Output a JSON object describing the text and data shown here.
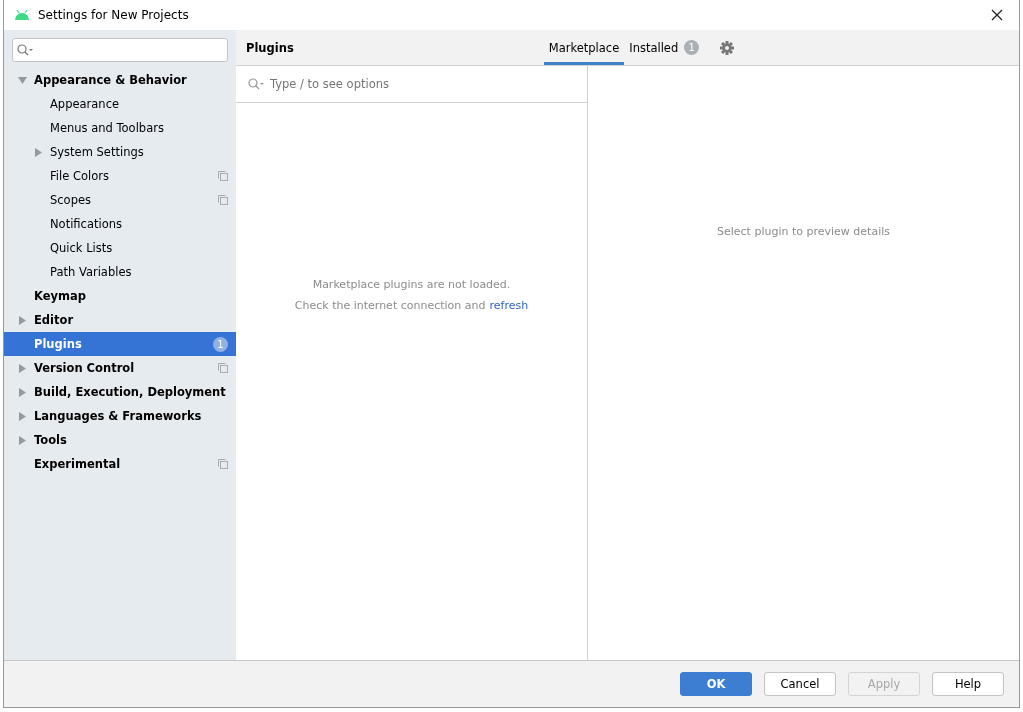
{
  "window": {
    "title": "Settings for New Projects"
  },
  "sidebar": {
    "items": [
      {
        "label": "Appearance & Behavior",
        "bold": true,
        "expanded": true,
        "selected": false,
        "per_project": false,
        "children": [
          {
            "label": "Appearance",
            "bold": false,
            "selected": false,
            "per_project": false
          },
          {
            "label": "Menus and Toolbars",
            "bold": false,
            "selected": false,
            "per_project": false
          },
          {
            "label": "System Settings",
            "bold": false,
            "expanded": false,
            "selected": false,
            "per_project": false
          },
          {
            "label": "File Colors",
            "bold": false,
            "selected": false,
            "per_project": true
          },
          {
            "label": "Scopes",
            "bold": false,
            "selected": false,
            "per_project": true
          },
          {
            "label": "Notifications",
            "bold": false,
            "selected": false,
            "per_project": false
          },
          {
            "label": "Quick Lists",
            "bold": false,
            "selected": false,
            "per_project": false
          },
          {
            "label": "Path Variables",
            "bold": false,
            "selected": false,
            "per_project": false
          }
        ]
      },
      {
        "label": "Keymap",
        "bold": true,
        "selected": false,
        "per_project": false
      },
      {
        "label": "Editor",
        "bold": true,
        "expanded": false,
        "selected": false,
        "per_project": false
      },
      {
        "label": "Plugins",
        "bold": true,
        "selected": true,
        "per_project": false,
        "badge": "1"
      },
      {
        "label": "Version Control",
        "bold": true,
        "expanded": false,
        "selected": false,
        "per_project": true
      },
      {
        "label": "Build, Execution, Deployment",
        "bold": true,
        "expanded": false,
        "selected": false,
        "per_project": false
      },
      {
        "label": "Languages & Frameworks",
        "bold": true,
        "expanded": false,
        "selected": false,
        "per_project": false
      },
      {
        "label": "Tools",
        "bold": true,
        "expanded": false,
        "selected": false,
        "per_project": false
      },
      {
        "label": "Experimental",
        "bold": true,
        "selected": false,
        "per_project": true
      }
    ]
  },
  "header": {
    "title": "Plugins",
    "tabs": [
      {
        "label": "Marketplace",
        "selected": true
      },
      {
        "label": "Installed",
        "selected": false,
        "badge": "1"
      }
    ]
  },
  "plugin_list": {
    "search": {
      "placeholder": "Type / to see options"
    },
    "message_line_1": "Marketplace plugins are not loaded.",
    "message_line_2": "Check the internet connection and",
    "link": "refresh"
  },
  "details": {
    "message": "Select plugin to preview details"
  },
  "buttons": [
    {
      "label": "OK",
      "primary": true,
      "disabled": false
    },
    {
      "label": "Cancel",
      "primary": false,
      "disabled": false
    },
    {
      "label": "Apply",
      "primary": false,
      "disabled": true
    },
    {
      "label": "Help",
      "primary": false,
      "disabled": false
    }
  ]
}
